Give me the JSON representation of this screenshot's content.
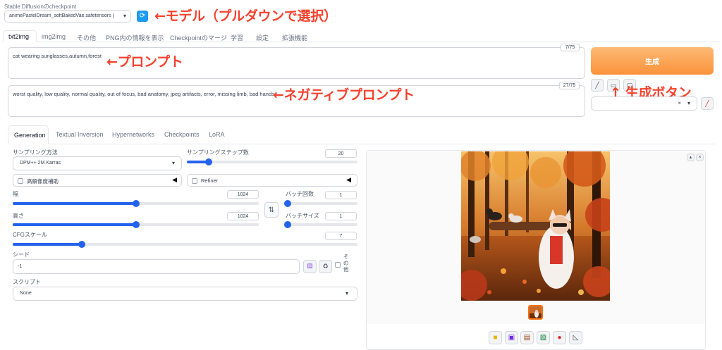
{
  "header": {
    "checkpoint_label": "Stable Diffusionのcheckpoint",
    "checkpoint_value": "animePastelDream_softBakedVae.safetensors [",
    "annotation_model": "←モデル（プルダウンで選択）"
  },
  "main_tabs": [
    "txt2img",
    "img2img",
    "その他",
    "PNG内の情報を表示",
    "Checkpointのマージ",
    "学習",
    "設定",
    "拡張機能"
  ],
  "prompt": {
    "value": "cat wearing sunglasses,autumn,forest",
    "counter": "7/75",
    "annotation": "←プロンプト"
  },
  "negative_prompt": {
    "value": "worst quality, low quality, normal quality,  out of focus, bad anatomy, jpeg artifacts, error, missing limb, bad hands",
    "counter": "27/75",
    "annotation": "←ネガティブプロンプト"
  },
  "generate": {
    "label": "生成",
    "annotation": "↑ 生成ボタン"
  },
  "sub_tabs": [
    "Generation",
    "Textual Inversion",
    "Hypernetworks",
    "Checkpoints",
    "LoRA"
  ],
  "settings": {
    "sampler_label": "サンプリング方法",
    "sampler_value": "DPM++ 2M Karras",
    "steps_label": "サンプリングステップ数",
    "steps_value": "20",
    "steps_fraction": 0.13,
    "hires_label": "高解像度補助",
    "refiner_label": "Refiner",
    "width_label": "幅",
    "width_value": "1024",
    "width_fraction": 0.5,
    "height_label": "高さ",
    "height_value": "1024",
    "height_fraction": 0.5,
    "batch_count_label": "バッチ回数",
    "batch_count_value": "1",
    "batch_size_label": "バッチサイズ",
    "batch_size_value": "1",
    "cfg_label": "CFGスケール",
    "cfg_value": "7",
    "cfg_fraction": 0.2,
    "seed_label": "シード",
    "seed_value": "-1",
    "extra_label": "その他",
    "script_label": "スクリプト",
    "script_value": "None"
  }
}
